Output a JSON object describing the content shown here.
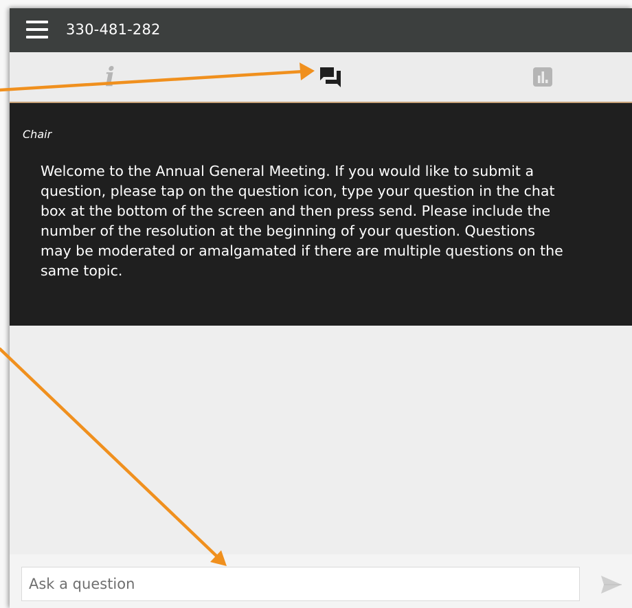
{
  "header": {
    "meeting_id": "330-481-282"
  },
  "tabs": [
    {
      "name": "info",
      "icon": "info-icon",
      "active": false
    },
    {
      "name": "chat",
      "icon": "chat-icon",
      "active": true
    },
    {
      "name": "poll",
      "icon": "poll-icon",
      "active": false
    }
  ],
  "message": {
    "sender": "Chair",
    "text": "Welcome to the Annual General Meeting. If you would like to submit a question, please tap on the question icon, type your question in the chat box at the bottom of the screen and then press send. Please include the number of the resolution at the beginning of your question. Questions may be moderated or amalgamated if there are multiple questions on the same topic."
  },
  "composer": {
    "placeholder": "Ask a question",
    "value": ""
  },
  "info_glyph": "i",
  "colors": {
    "header_bg": "#3c3f3e",
    "tab_active": "#1f1f1f",
    "tab_inactive": "#b5b5b5",
    "message_bg": "#1f1f1f",
    "accent_border": "#c9a37a",
    "annotation_arrow": "#f0901e"
  }
}
